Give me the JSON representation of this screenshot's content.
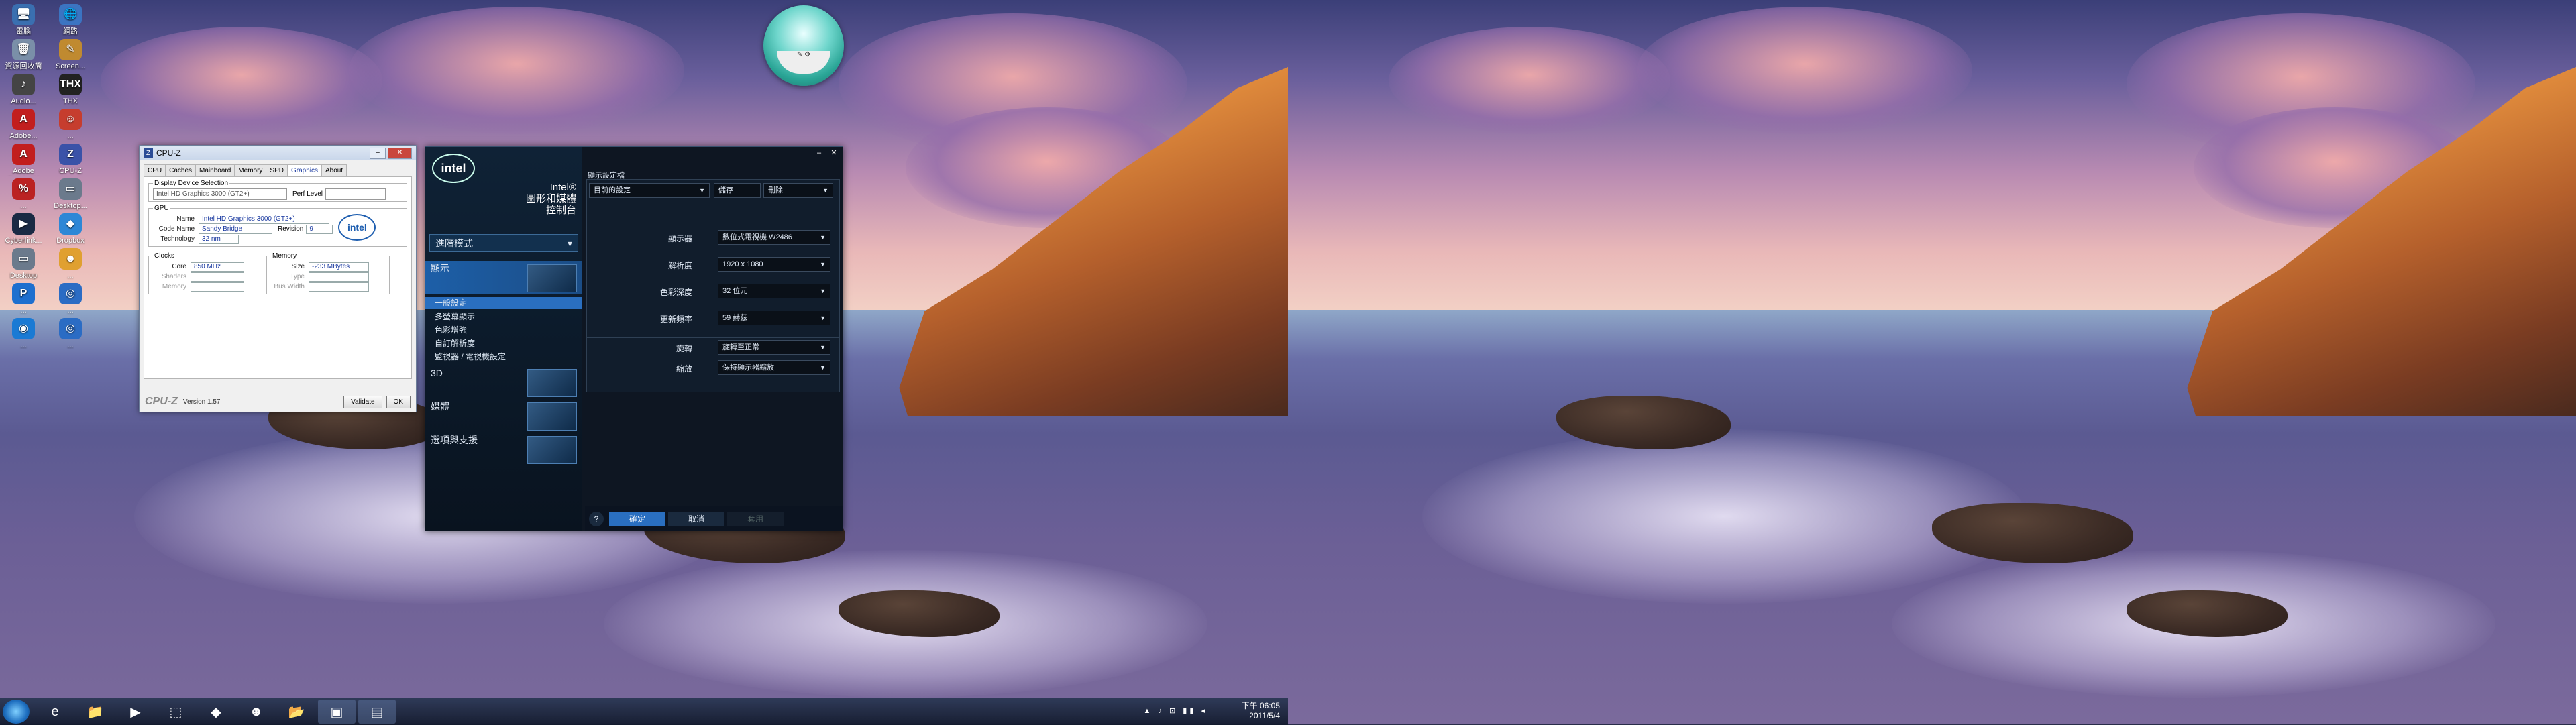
{
  "desktop_icons": [
    {
      "label": "電腦",
      "glyph": "🖥",
      "color": "#3a6fb0"
    },
    {
      "label": "網路",
      "glyph": "🌐",
      "color": "#3b74c2"
    },
    {
      "label": "資源回收筒",
      "glyph": "🗑",
      "color": "#7a8fa8"
    },
    {
      "label": "Screen...",
      "glyph": "✎",
      "color": "#c08a30"
    },
    {
      "label": "Audio...",
      "glyph": "♪",
      "color": "#444"
    },
    {
      "label": "THX",
      "glyph": "THX",
      "color": "#222"
    },
    {
      "label": "Adobe...",
      "glyph": "A",
      "color": "#c21e1e"
    },
    {
      "label": "...",
      "glyph": "☺",
      "color": "#c63d2e"
    },
    {
      "label": "Adobe Reader X",
      "glyph": "A",
      "color": "#c21e1e"
    },
    {
      "label": "CPU-Z",
      "glyph": "Z",
      "color": "#3a52a8"
    },
    {
      "label": "...",
      "glyph": "%",
      "color": "#b22"
    },
    {
      "label": "Desktop...",
      "glyph": "▭",
      "color": "#6b7a8c"
    },
    {
      "label": "Cyberlink...",
      "glyph": "▶",
      "color": "#1a2a44"
    },
    {
      "label": "Dropbox",
      "glyph": "◆",
      "color": "#2d87d6"
    },
    {
      "label": "Desktop",
      "glyph": "▭",
      "color": "#6b7a8c"
    },
    {
      "label": "...",
      "glyph": "☻",
      "color": "#e0a030"
    },
    {
      "label": "...",
      "glyph": "P",
      "color": "#1d6fcf"
    },
    {
      "label": "...",
      "glyph": "◎",
      "color": "#2b6cc4"
    },
    {
      "label": "...",
      "glyph": "◉",
      "color": "#1a7ad4"
    },
    {
      "label": "...",
      "glyph": "◎",
      "color": "#2b6cc4"
    }
  ],
  "cpuz": {
    "title": "CPU-Z",
    "tabs": [
      "CPU",
      "Caches",
      "Mainboard",
      "Memory",
      "SPD",
      "Graphics",
      "About"
    ],
    "active_tab": "Graphics",
    "display_device_legend": "Display Device Selection",
    "device": "Intel HD Graphics 3000 (GT2+)",
    "perf_level_label": "Perf Level",
    "gpu_legend": "GPU",
    "name_label": "Name",
    "name": "Intel HD Graphics 3000 (GT2+)",
    "code_name_label": "Code Name",
    "code_name": "Sandy Bridge",
    "revision_label": "Revision",
    "revision": "9",
    "technology_label": "Technology",
    "technology": "32 nm",
    "clocks_legend": "Clocks",
    "core_label": "Core",
    "core": "850 MHz",
    "shaders_label": "Shaders",
    "memory_clk_label": "Memory",
    "memory_legend": "Memory",
    "size_label": "Size",
    "size": "-233 MBytes",
    "type_label": "Type",
    "bus_width_label": "Bus Width",
    "brand": "CPU-Z",
    "version": "Version 1.57",
    "validate_label": "Validate",
    "ok_label": "OK",
    "intel_badge": "intel"
  },
  "intel_panel": {
    "logo": "intel",
    "title_line1": "Intel®",
    "title_line2": "圖形和媒體",
    "title_line3": "控制台",
    "mode": "進階模式",
    "menu": [
      {
        "label": "顯示",
        "active": true
      },
      {
        "label": "3D",
        "active": false
      },
      {
        "label": "媒體",
        "active": false
      },
      {
        "label": "選項與支援",
        "active": false
      }
    ],
    "submenu": [
      "一般設定",
      "多螢幕顯示",
      "色彩增強",
      "自訂解析度",
      "監視器 / 電視機設定"
    ],
    "selected_submenu": "一般設定",
    "section_title": "顯示設定檔",
    "profile": "目前的設定",
    "save_label": "儲存",
    "delete_label": "刪除",
    "settings": [
      {
        "label": "顯示器",
        "value": "數位式電視機 W2486"
      },
      {
        "label": "解析度",
        "value": "1920 x 1080"
      },
      {
        "label": "色彩深度",
        "value": "32 位元"
      },
      {
        "label": "更新頻率",
        "value": "59 赫茲"
      }
    ],
    "rotation_label": "旋轉",
    "rotation_value": "旋轉至正常",
    "scaling_label": "縮放",
    "scaling_value": "保持顯示器縮放",
    "help_label": "?",
    "ok_label": "確定",
    "cancel_label": "取消",
    "apply_label": "套用"
  },
  "gadget": {
    "label": "✎ ⚙"
  },
  "taskbar": {
    "clock_time": "下午 06:05",
    "clock_date": "2011/5/4",
    "tray": "▲ ♪ ⊡ ▮▮ ◂",
    "pinned": [
      "e",
      "📁",
      "▶",
      "⬚",
      "◆",
      "☻",
      "📂",
      "▣",
      "▤"
    ]
  }
}
